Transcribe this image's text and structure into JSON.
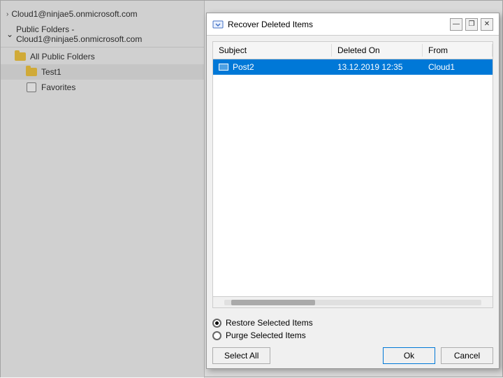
{
  "background": {
    "account_label": "Cloud1@ninjae5.onmicrosoft.com",
    "public_folders_label": "Public Folders - Cloud1@ninjae5.onmicrosoft.com",
    "all_public_folders_label": "All Public Folders",
    "test1_label": "Test1",
    "favorites_label": "Favorites"
  },
  "modal": {
    "title": "Recover Deleted Items",
    "title_icon": "recover-icon",
    "columns": {
      "subject": "Subject",
      "deleted_on": "Deleted On",
      "from": "From"
    },
    "rows": [
      {
        "subject": "Post2",
        "deleted_on": "13.12.2019 12:35",
        "from": "Cloud1",
        "selected": true
      }
    ],
    "radio_options": [
      {
        "label": "Restore Selected Items",
        "checked": true
      },
      {
        "label": "Purge Selected Items",
        "checked": false
      }
    ],
    "buttons": {
      "select_all": "Select All",
      "ok": "Ok",
      "cancel": "Cancel"
    },
    "window_controls": {
      "minimize": "—",
      "restore": "❐",
      "close": "✕"
    }
  }
}
